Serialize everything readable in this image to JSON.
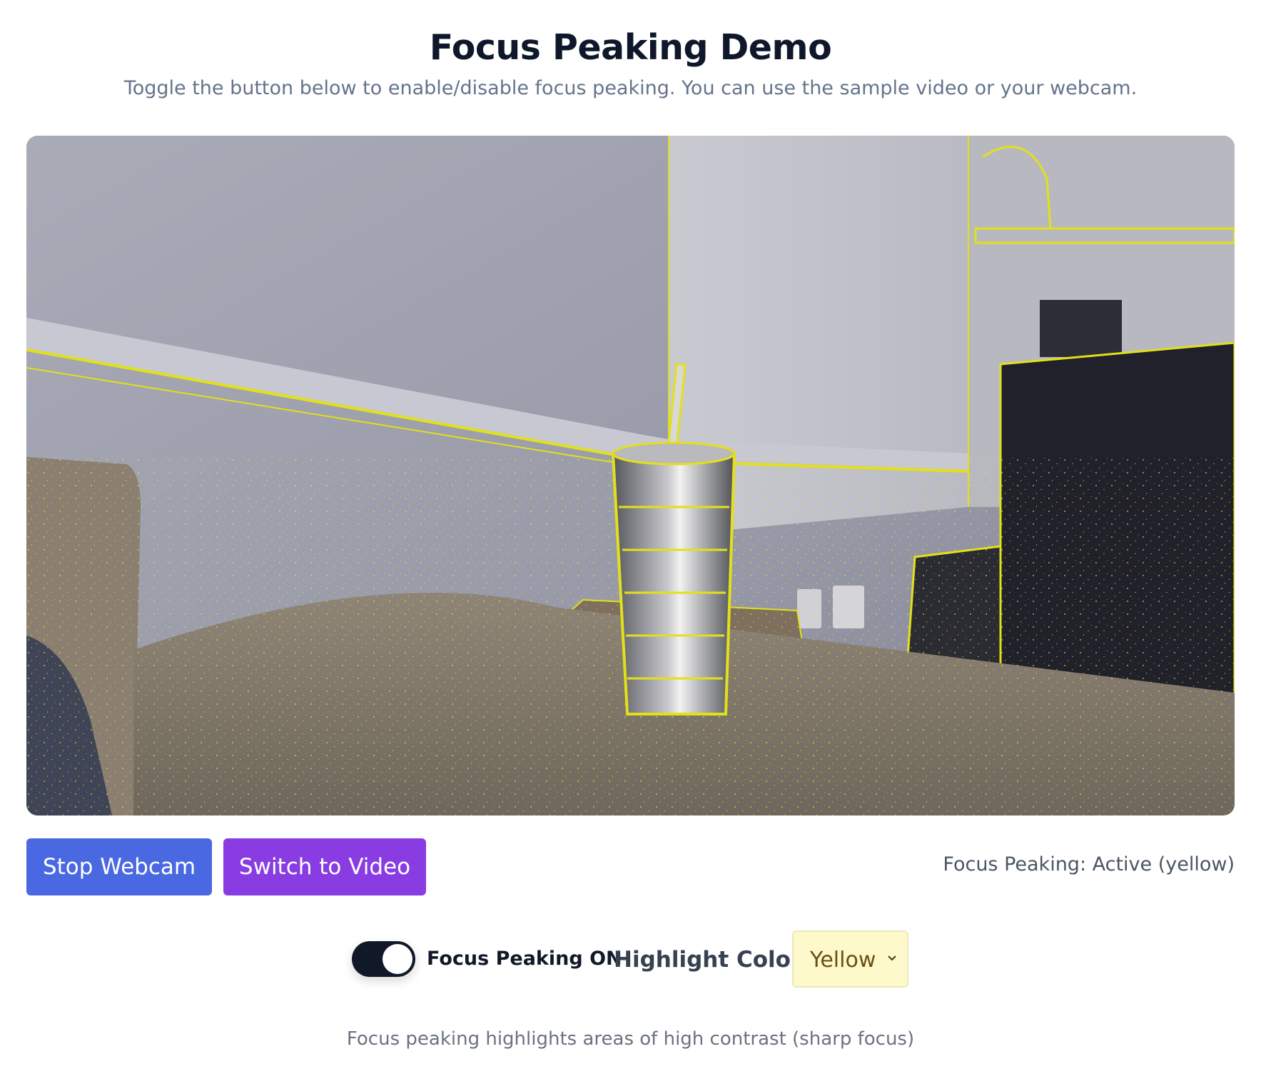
{
  "header": {
    "title": "Focus Peaking Demo",
    "subtitle": "Toggle the button below to enable/disable focus peaking. You can use the sample video or your webcam."
  },
  "video": {
    "description_icon": "webcam-feed",
    "peaking_color": "#f4f21a"
  },
  "buttons": {
    "stop_label": "Stop Webcam",
    "switch_label": "Switch to Video",
    "stop_color": "#4a68e2",
    "switch_color": "#8a3ce3"
  },
  "status": {
    "text": "Focus Peaking: Active (yellow)"
  },
  "controls": {
    "toggle_label": "Focus Peaking ON",
    "toggle_on": true,
    "color_label": "Highlight Color:",
    "color_value": "Yellow",
    "select_icon": "chevron-down-icon"
  },
  "footer": {
    "note": "Focus peaking highlights areas of high contrast (sharp focus)"
  }
}
